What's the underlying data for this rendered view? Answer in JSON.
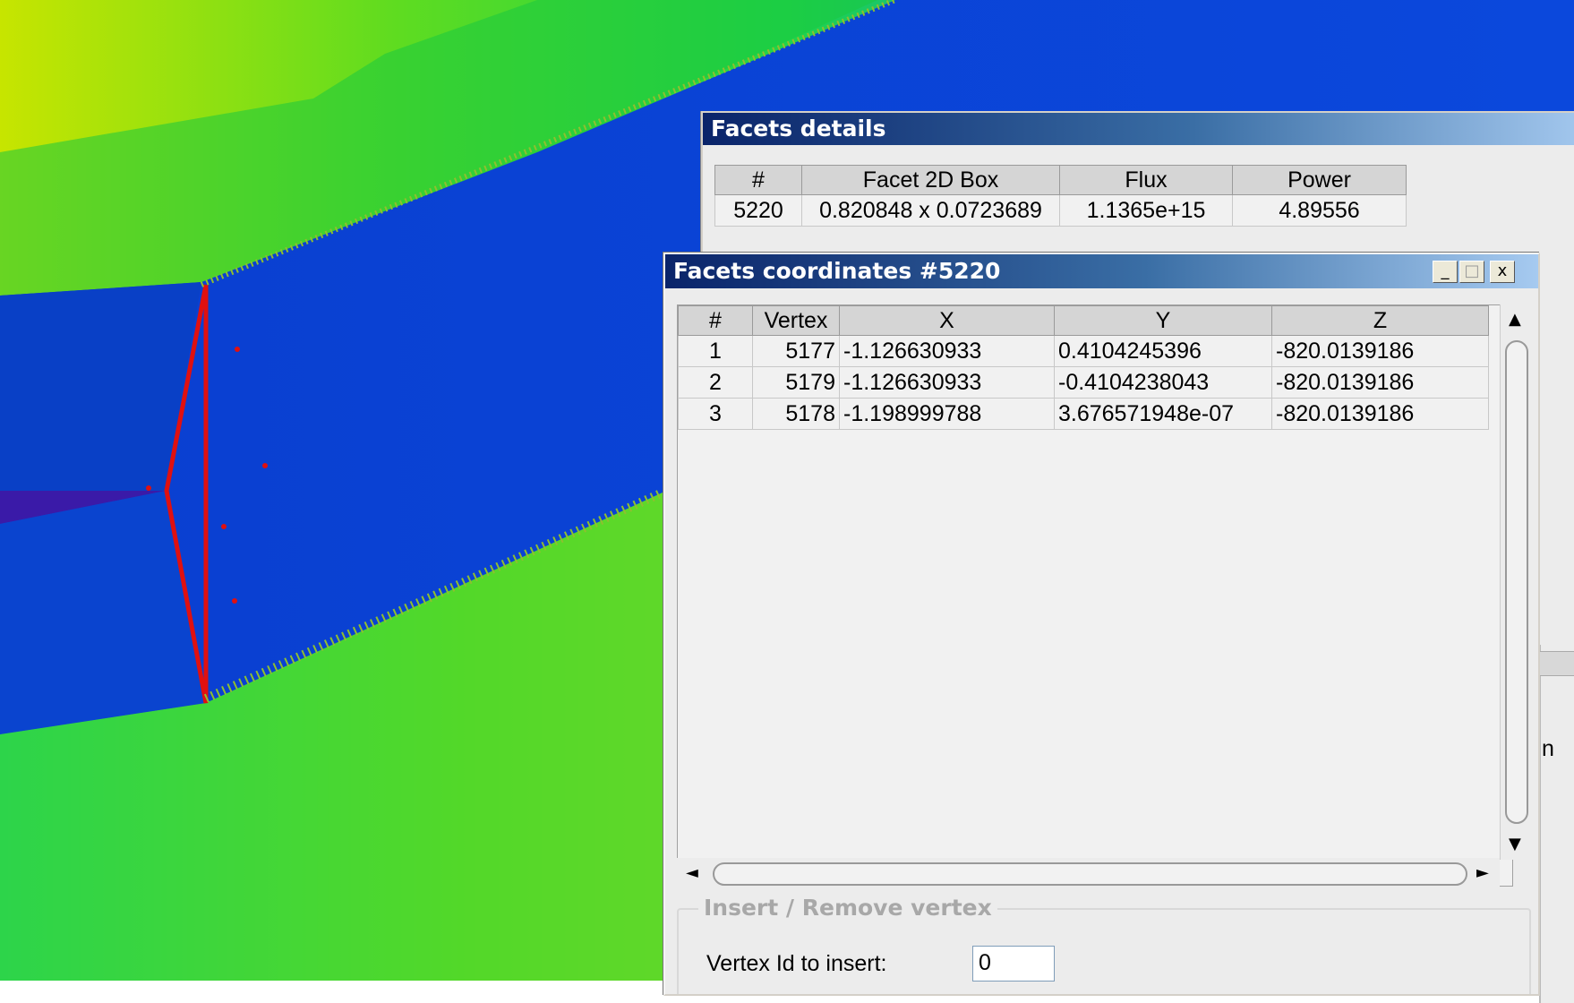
{
  "details_window": {
    "title": "Facets details",
    "columns": [
      "#",
      "Facet 2D Box",
      "Flux",
      "Power"
    ],
    "rows": [
      [
        "5220",
        "0.820848 x 0.0723689",
        "1.1365e+15",
        "4.89556"
      ]
    ]
  },
  "coords_window": {
    "title": "Facets coordinates #5220",
    "minimize_glyph": "_",
    "maximize_glyph": "□",
    "close_glyph": "x",
    "columns": [
      "#",
      "Vertex",
      "X",
      "Y",
      "Z"
    ],
    "rows": [
      [
        "1",
        "5177",
        "-1.126630933",
        "0.4104245396",
        "-820.0139186"
      ],
      [
        "2",
        "5179",
        "-1.126630933",
        "-0.4104238043",
        "-820.0139186"
      ],
      [
        "3",
        "5178",
        "-1.198999788",
        "3.676571948e-07",
        "-820.0139186"
      ]
    ],
    "group_title": "Insert / Remove vertex",
    "vertex_label": "Vertex Id to insert:",
    "vertex_value": "0",
    "scroll_up": "▲",
    "scroll_down": "▼",
    "scroll_left": "◄",
    "scroll_right": "►"
  },
  "partial_text": "n"
}
